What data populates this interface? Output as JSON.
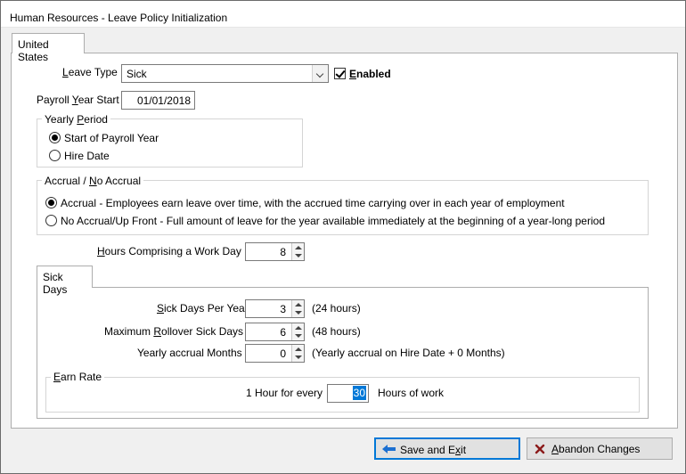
{
  "window": {
    "title": "Human Resources - Leave Policy Initialization"
  },
  "tabs": {
    "country": "United States",
    "sick_days": "Sick Days"
  },
  "leave_type": {
    "label": "Leave Type",
    "value": "Sick",
    "enabled_label": "Enabled",
    "enabled_checked": true
  },
  "payroll_year_start": {
    "label": "Payroll Year Start",
    "value": "01/01/2018"
  },
  "yearly_period": {
    "label": "Yearly Period",
    "options": [
      {
        "label": "Start of Payroll Year",
        "selected": true
      },
      {
        "label": "Hire Date",
        "selected": false
      }
    ]
  },
  "accrual": {
    "label": "Accrual / No Accrual",
    "options": [
      {
        "label": "Accrual - Employees earn leave over time, with the accrued time carrying over in each year of employment",
        "selected": true
      },
      {
        "label": "No Accrual/Up Front - Full amount of leave for the year available immediately at the beginning of a year-long period",
        "selected": false
      }
    ]
  },
  "hours_work_day": {
    "label": "Hours Comprising a Work Day",
    "value": "8"
  },
  "sick_days": {
    "per_year": {
      "label": "Sick Days Per Year",
      "value": "3",
      "note": "(24 hours)"
    },
    "max_rollover": {
      "label": "Maximum Rollover Sick Days",
      "value": "6",
      "note": "(48 hours)"
    },
    "accrual_months": {
      "label": "Yearly accrual Months",
      "value": "0",
      "note": "(Yearly accrual on Hire Date + 0 Months)"
    }
  },
  "earn_rate": {
    "label": "Earn Rate",
    "prefix": "1 Hour for every",
    "value": "30",
    "suffix": "Hours of work"
  },
  "buttons": {
    "save": "Save and Exit",
    "abandon": "Abandon Changes"
  },
  "colors": {
    "accent": "#0078d7",
    "selection": "#0078d7",
    "abandon_icon": "#8b1a1a",
    "save_icon": "#1b6fd1"
  },
  "icons": {
    "save": "arrow-left-icon",
    "abandon": "x-icon"
  }
}
